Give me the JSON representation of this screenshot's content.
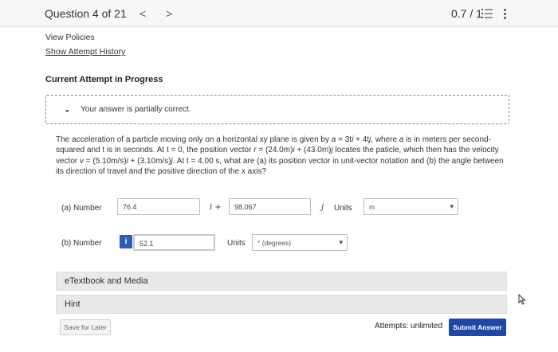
{
  "header": {
    "question_label": "Question 4 of 21",
    "prev_glyph": "<",
    "next_glyph": ">",
    "score": "0.7 / 1"
  },
  "links": {
    "view_policies": "View Policies",
    "show_history": "Show Attempt History"
  },
  "attempt_heading": "Current Attempt in Progress",
  "feedback": {
    "symbol": "-",
    "message": "Your answer is partially correct."
  },
  "question": {
    "p1": "The acceleration of a particle moving only on a horizontal xy plane is given by ",
    "a_vec": "a",
    "eq1": " = 3t",
    "i_hat": "i",
    "eq2": " + 4t",
    "j_hat": "j",
    "p2": ", where ",
    "p3": " is in meters per second-squared and t is in seconds. At t = 0, the position vector ",
    "r_vec": "r",
    "eq3": " = (24.0m)",
    "eq4": " + (43.0m)",
    "p4": " locates the paticle, which then has the velocity vector ",
    "v_vec": "v",
    "eq5": " = (5.10m/s)",
    "eq6": " + (3.10m/s)",
    "p5": ". At t = 4.00 s, what are (a) its position vector in unit-vector notation and (b) the angle between its direction of travel and the positive direction of the x axis?"
  },
  "part_a": {
    "label": "(a)  Number",
    "value_i": "76.4",
    "i_unit": "i +",
    "value_j": "98.067",
    "j_unit": "j",
    "units_label": "Units",
    "units_value": "m"
  },
  "part_b": {
    "label": "(b)  Number",
    "info": "i",
    "value": "52.1",
    "units_label": "Units",
    "units_value": "° (degrees)"
  },
  "etextbook": "eTextbook and Media",
  "hint": "Hint",
  "footer": {
    "save_label": "Save for Later",
    "attempts_label": "Attempts: unlimited",
    "submit_label": "Submit Answer"
  }
}
